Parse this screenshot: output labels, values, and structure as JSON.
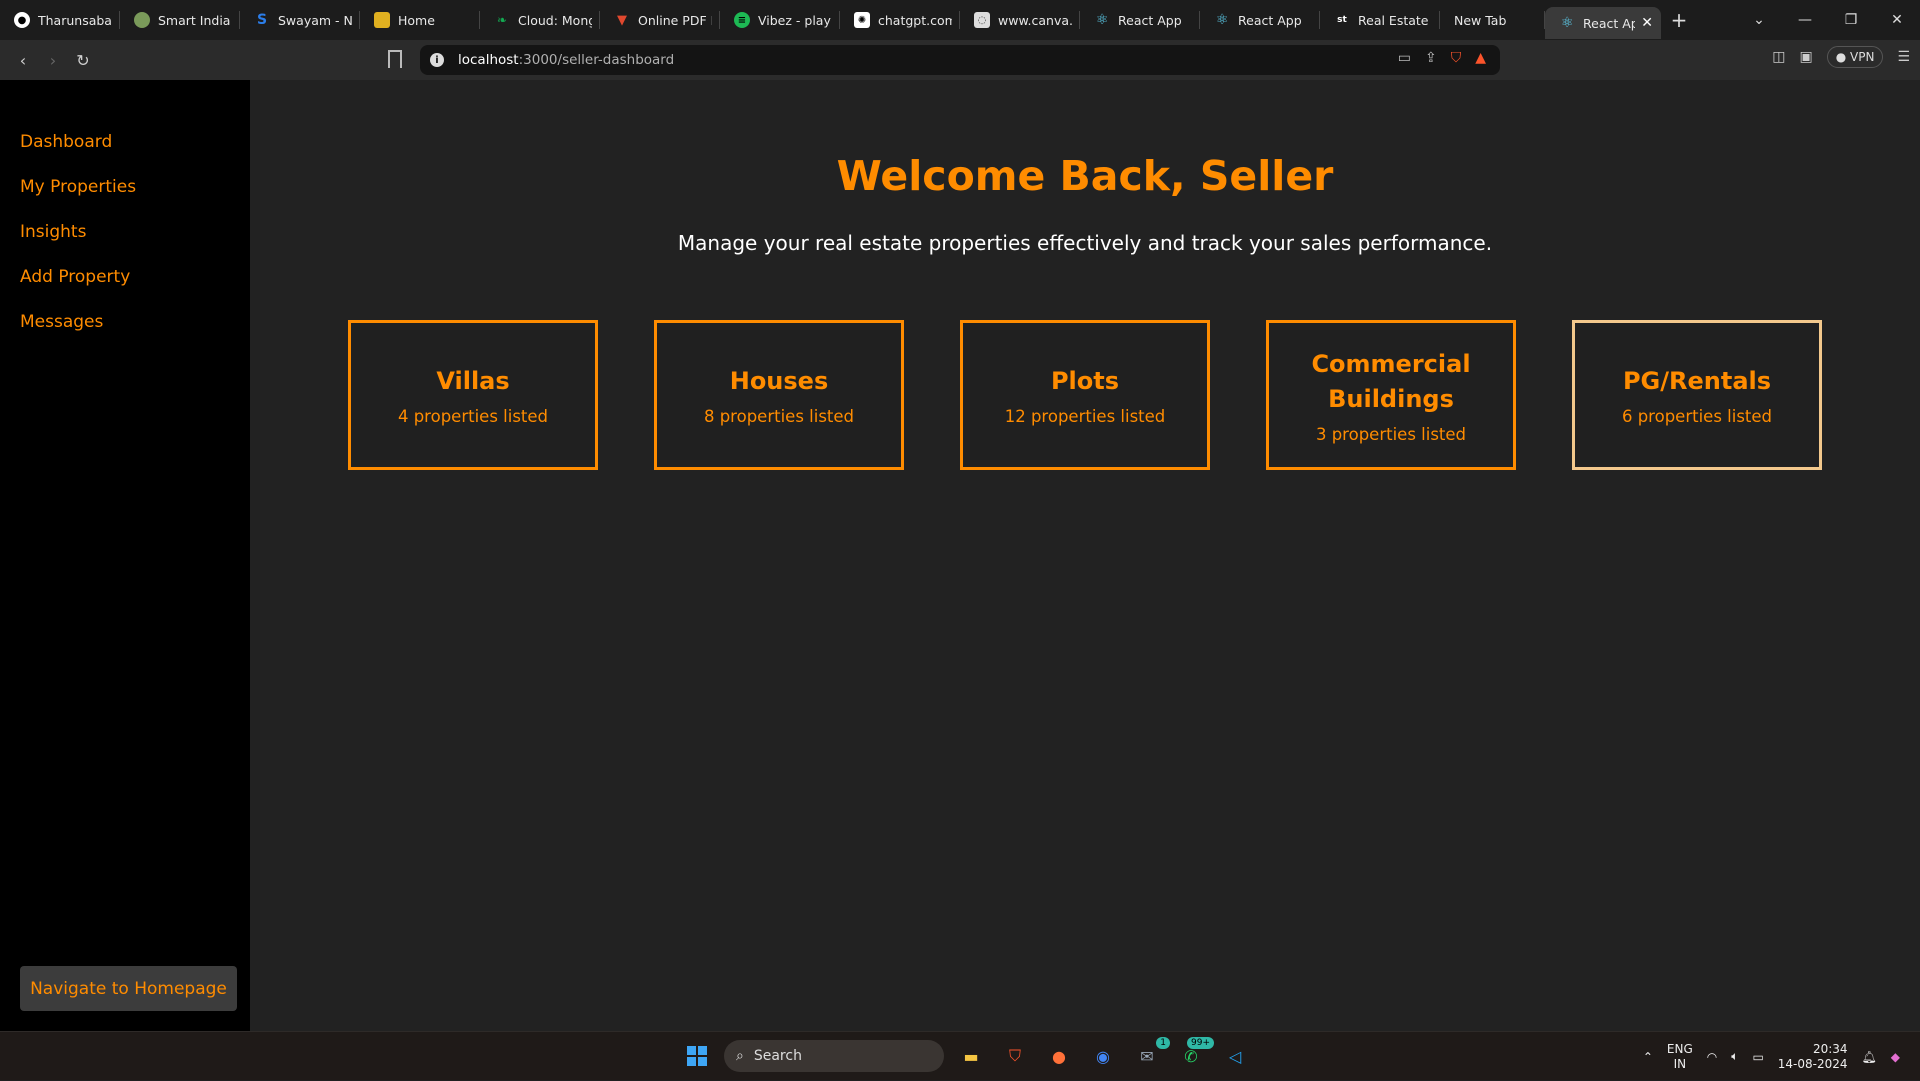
{
  "browser": {
    "tabs": [
      {
        "title": "Tharunsabari",
        "icon": "github-icon",
        "color": "#ffffff"
      },
      {
        "title": "Smart India H",
        "icon": "pin-icon",
        "color": "#7a9a5a"
      },
      {
        "title": "Swayam - NP",
        "icon": "swayam-icon",
        "color": "#2b7de9"
      },
      {
        "title": "Home",
        "icon": "home-icon",
        "color": "#e0b020"
      },
      {
        "title": "Cloud: Mong",
        "icon": "mongo-leaf-icon",
        "color": "#13aa52"
      },
      {
        "title": "Online PDF E",
        "icon": "pdf-icon",
        "color": "#e0482e"
      },
      {
        "title": "Vibez - playli",
        "icon": "spotify-icon",
        "color": "#1db954"
      },
      {
        "title": "chatgpt.com",
        "icon": "chatgpt-icon",
        "color": "#ffffff"
      },
      {
        "title": "www.canva.c",
        "icon": "canva-icon",
        "color": "#dddddd"
      },
      {
        "title": "React App",
        "icon": "react-icon",
        "color": "#61dafb"
      },
      {
        "title": "React App",
        "icon": "react-icon",
        "color": "#61dafb"
      },
      {
        "title": "Real Estate B",
        "icon": "site-icon",
        "color": "#ffffff"
      },
      {
        "title": "New Tab",
        "icon": "",
        "color": ""
      }
    ],
    "active_tab": {
      "title": "React Ap",
      "icon": "react-icon"
    },
    "url_host": "localhost",
    "url_path": ":3000/seller-dashboard",
    "vpn_label": "VPN"
  },
  "sidebar": {
    "items": [
      {
        "label": "Dashboard"
      },
      {
        "label": "My Properties"
      },
      {
        "label": "Insights"
      },
      {
        "label": "Add Property"
      },
      {
        "label": "Messages"
      }
    ],
    "home_button": "Navigate to Homepage"
  },
  "main": {
    "heading": "Welcome Back, Seller",
    "subheading": "Manage your real estate properties effectively and track your sales performance.",
    "cards": [
      {
        "title": "Villas",
        "count": "4 properties listed"
      },
      {
        "title": "Houses",
        "count": "8 properties listed"
      },
      {
        "title": "Plots",
        "count": "12 properties listed"
      },
      {
        "title": "Commercial Buildings",
        "count": "3 properties listed"
      },
      {
        "title": "PG/Rentals",
        "count": "6 properties listed"
      }
    ]
  },
  "taskbar": {
    "search_placeholder": "Search",
    "whatsapp_badge": "99+",
    "mail_badge": "1",
    "lang": "ENG",
    "region": "IN",
    "time": "20:34",
    "date": "14-08-2024"
  },
  "colors": {
    "accent": "#ff8c00",
    "sidebar_bg": "#000000",
    "content_bg": "#222222"
  }
}
